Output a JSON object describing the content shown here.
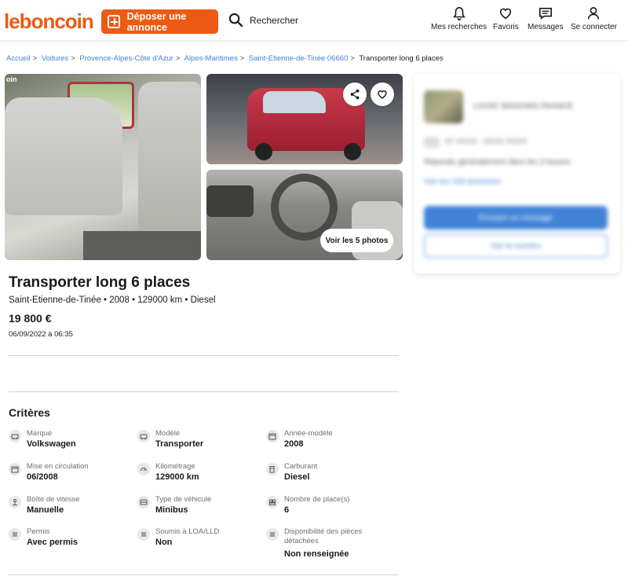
{
  "header": {
    "logo": "leboncoin",
    "post_button": "Déposer une annonce",
    "search_label": "Rechercher",
    "nav": [
      {
        "label": "Mes recherches",
        "icon": "bell-icon"
      },
      {
        "label": "Favoris",
        "icon": "heart-icon"
      },
      {
        "label": "Messages",
        "icon": "message-icon"
      },
      {
        "label": "Se connecter",
        "icon": "user-icon"
      }
    ]
  },
  "breadcrumb": [
    "Accueil",
    "Voitures",
    "Provence-Alpes-Côte d'Azur",
    "Alpes-Maritimes",
    "Saint-Etienne-de-Tinée 06660",
    "Transporter long 6 places"
  ],
  "photos": {
    "watermark": "oin",
    "see_photos": "Voir les 5 photos"
  },
  "seller": {
    "name": "LOUIS' MAISONS FRANCE",
    "phone": "07 XXXX - 0XXX XXXX",
    "hours": "Répondu généralement dans les 3 heures",
    "link": "Voir les 158 annonces",
    "message_button": "Envoyer un message",
    "number_button": "Voir le numéro"
  },
  "ad": {
    "title": "Transporter long 6 places",
    "subtitle": "Saint-Etienne-de-Tinée • 2008 • 129000 km • Diesel",
    "price": "19 800 €",
    "date": "06/09/2022 à 06:35"
  },
  "criteria": {
    "title": "Critères",
    "items": [
      {
        "label": "Marque",
        "value": "Volkswagen",
        "icon": "car-icon"
      },
      {
        "label": "Modèle",
        "value": "Transporter",
        "icon": "car-icon"
      },
      {
        "label": "Année-modèle",
        "value": "2008",
        "icon": "calendar-icon"
      },
      {
        "label": "Mise en circulation",
        "value": "06/2008",
        "icon": "calendar-icon"
      },
      {
        "label": "Kilométrage",
        "value": "129000 km",
        "icon": "speedometer-icon"
      },
      {
        "label": "Carburant",
        "value": "Diesel",
        "icon": "fuel-icon"
      },
      {
        "label": "Boîte de vitesse",
        "value": "Manuelle",
        "icon": "gearbox-icon"
      },
      {
        "label": "Type de véhicule",
        "value": "Minibus",
        "icon": "vehicle-icon"
      },
      {
        "label": "Nombre de place(s)",
        "value": "6",
        "icon": "seat-icon"
      },
      {
        "label": "Permis",
        "value": "Avec permis",
        "icon": "list-icon"
      },
      {
        "label": "Soumis à LOA/LLD",
        "value": "Non",
        "icon": "list-icon"
      },
      {
        "label": "Disponibilité des pièces détachées",
        "value": "Non renseignée",
        "icon": "list-icon"
      }
    ]
  },
  "colors": {
    "brand": "#ec5a13",
    "link": "#4183d7"
  }
}
